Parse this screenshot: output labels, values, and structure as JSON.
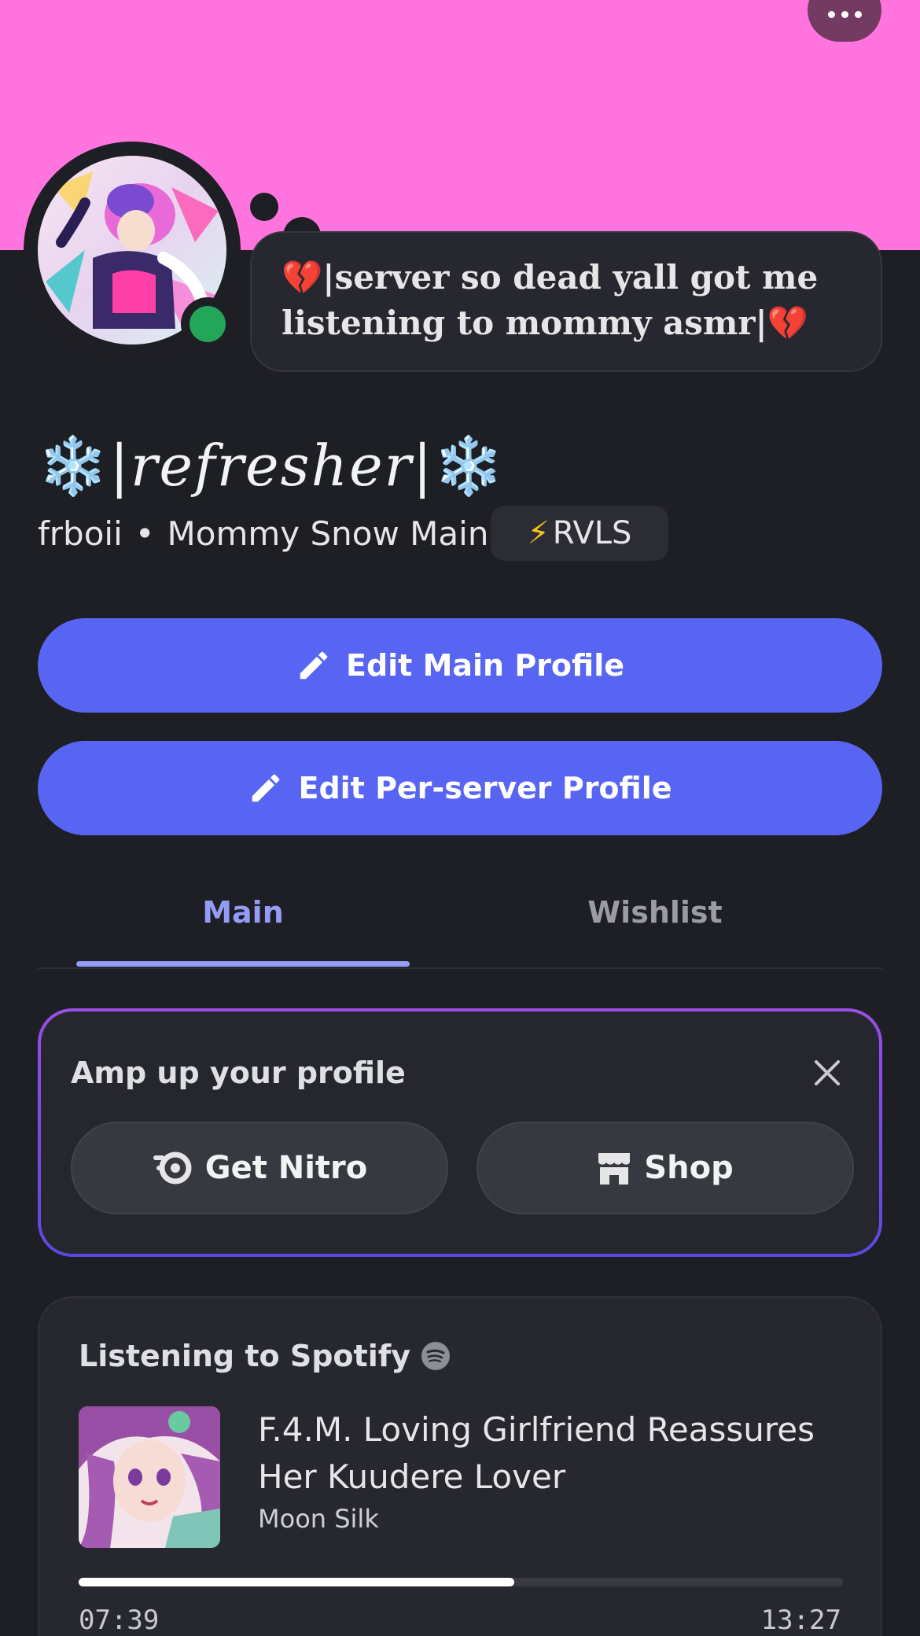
{
  "profile": {
    "banner_color": "#ff74de",
    "status_color": "#23a55a",
    "custom_status": {
      "emoji_start": "💔",
      "text": "|server so dead yall got me listening to mommy asmr|",
      "emoji_end": "💔"
    },
    "display_name": {
      "emoji_start": "❄️",
      "text": "|refresher|",
      "emoji_end": "❄️"
    },
    "username": "frboii",
    "separator": "•",
    "pronouns": "Mommy Snow Main",
    "tag": {
      "icon": "⚡",
      "label": "RVLS"
    }
  },
  "actions": {
    "edit_main": "Edit Main Profile",
    "edit_server": "Edit Per-server Profile"
  },
  "tabs": [
    {
      "label": "Main",
      "active": true
    },
    {
      "label": "Wishlist",
      "active": false
    }
  ],
  "amp_card": {
    "title": "Amp up your profile",
    "nitro_label": "Get Nitro",
    "shop_label": "Shop"
  },
  "activity": {
    "heading": "Listening to Spotify",
    "track": "F.4.M. Loving Girlfriend Reassures Her Kuudere Lover",
    "artist": "Moon Silk",
    "elapsed": "07:39",
    "total": "13:27",
    "progress": 0.57
  },
  "colors": {
    "accent": "#5865f2",
    "tab_active": "#949cf7"
  }
}
